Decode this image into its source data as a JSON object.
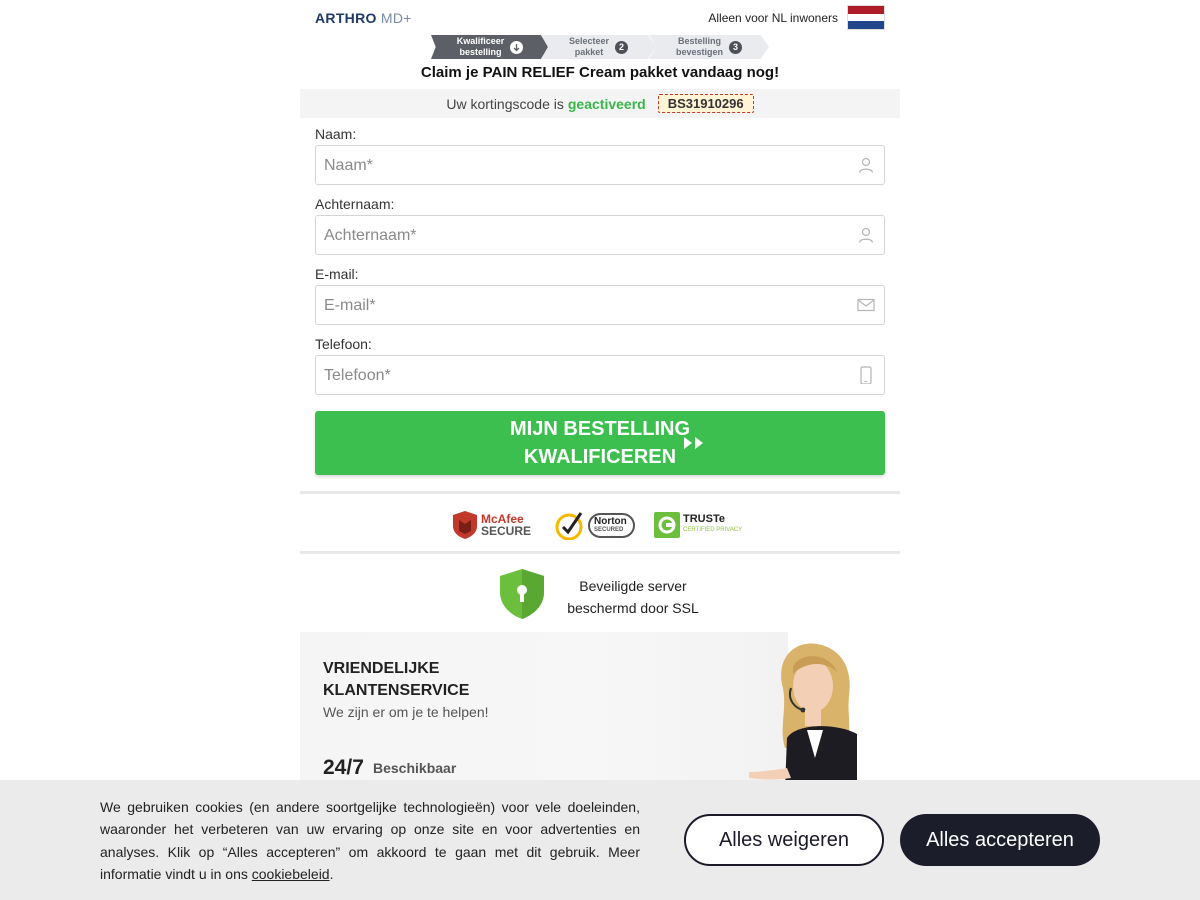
{
  "header": {
    "logo_main": "ARTHRO",
    "logo_suffix": "MD+",
    "country_notice": "Alleen voor NL inwoners",
    "flag_colors": [
      "#ae1c28",
      "#ffffff",
      "#21468b"
    ]
  },
  "steps": [
    {
      "label_line1": "Kwalificeer",
      "label_line2": "bestelling",
      "icon": "arrow-down-icon",
      "active": true
    },
    {
      "label_line1": "Selecteer",
      "label_line2": "pakket",
      "number": "2",
      "active": false
    },
    {
      "label_line1": "Bestelling",
      "label_line2": "bevestigen",
      "number": "3",
      "active": false
    }
  ],
  "claim_title": "Claim je PAIN RELIEF Cream pakket vandaag nog!",
  "discount": {
    "prefix": "Uw kortingscode is",
    "status": "geactiveerd",
    "code": "BS31910296"
  },
  "form": {
    "name": {
      "label": "Naam:",
      "placeholder": "Naam*",
      "icon": "user-icon"
    },
    "lastname": {
      "label": "Achternaam:",
      "placeholder": "Achternaam*",
      "icon": "user-icon"
    },
    "email": {
      "label": "E-mail:",
      "placeholder": "E-mail*",
      "icon": "envelope-icon"
    },
    "phone": {
      "label": "Telefoon:",
      "placeholder": "Telefoon*",
      "icon": "phone-icon"
    },
    "submit_line1": "MIJN BESTELLING",
    "submit_line2": "KWALIFICEREN"
  },
  "trust_badges": {
    "mcafee_top": "McAfee",
    "mcafee_bottom": "SECURE",
    "norton_top": "Norton",
    "norton_bottom": "SECURED",
    "truste_top": "TRUSTe",
    "truste_bottom": "CERTIFIED PRIVACY"
  },
  "ssl": {
    "line1": "Beveiligde server",
    "line2": "beschermd door SSL"
  },
  "customer_service": {
    "title_line1": "VRIENDELIJKE",
    "title_line2": "KLANTENSERVICE",
    "subtitle": "We zijn er om je te helpen!",
    "hours": "24/7",
    "availability": "Beschikbaar"
  },
  "cookie_banner": {
    "message": "We gebruiken cookies (en andere soortgelijke technologieën) voor vele doeleinden, waaronder het verbeteren van uw ervaring op onze site en voor advertenties en analyses. Klik op “Alles accepteren” om akkoord te gaan met dit gebruik. Meer informatie vindt u in ons ",
    "link_text": "cookiebeleid",
    "suffix": ".",
    "reject_label": "Alles weigeren",
    "accept_label": "Alles accepteren"
  },
  "colors": {
    "accent_green": "#3cbf4e",
    "brand_navy": "#1f3a68",
    "dark_button": "#1c1d2b"
  }
}
